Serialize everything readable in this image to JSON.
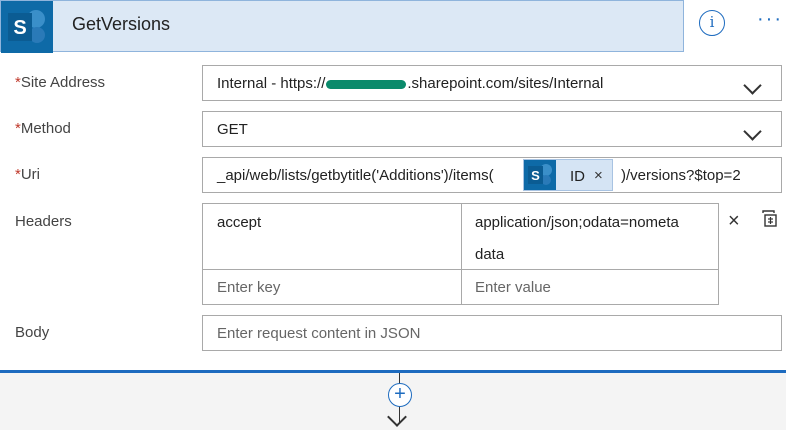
{
  "action": {
    "title": "GetVersions",
    "logo_icon": "sharepoint-icon"
  },
  "header_icons": {
    "info": "info-icon",
    "more": "more-options-icon"
  },
  "required_marker": "*",
  "fields": {
    "site_address": {
      "label": "Site Address",
      "value_prefix": "Internal - https://",
      "value_suffix": ".sharepoint.com/sites/Internal"
    },
    "method": {
      "label": "Method",
      "value": "GET"
    },
    "uri": {
      "label": "Uri",
      "value_prefix": "_api/web/lists/getbytitle('Additions')/items(",
      "value_suffix": ")/versions?$top=2",
      "token": {
        "label": "ID",
        "remove": "×"
      }
    },
    "headers": {
      "label": "Headers",
      "key": "accept",
      "value_line1": "application/json;odata=nometa",
      "value_line2": "data",
      "key_placeholder": "Enter key",
      "value_placeholder": "Enter value",
      "delete": "×"
    },
    "body": {
      "label": "Body",
      "placeholder": "Enter request content in JSON"
    }
  },
  "connector": {
    "add": "+"
  },
  "colors": {
    "accent": "#1d6bbf",
    "sharepoint": "#0e6aa7",
    "required": "#c0392b",
    "header_bg": "#dce8f5"
  }
}
